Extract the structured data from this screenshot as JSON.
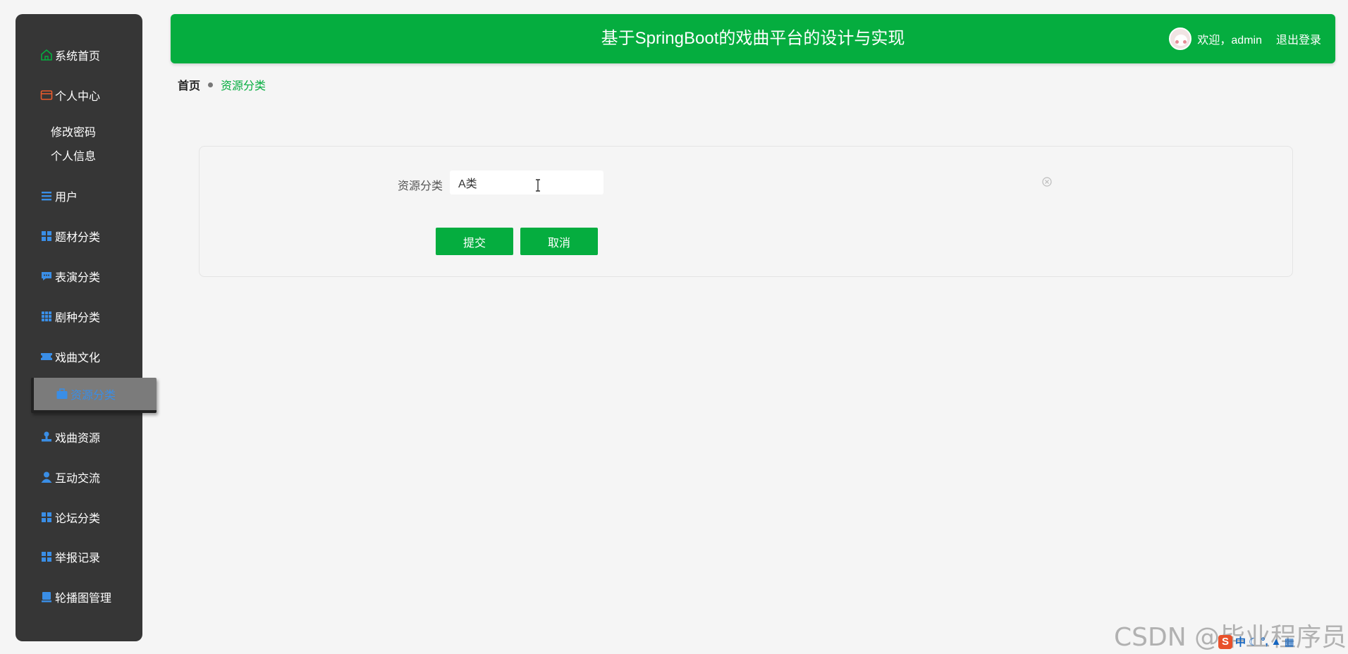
{
  "header": {
    "title": "基于SpringBoot的戏曲平台的设计与实现",
    "welcome": "欢迎，admin",
    "logout": "退出登录"
  },
  "sidebar": {
    "items": [
      {
        "label": "系统首页",
        "icon": "home-icon"
      },
      {
        "label": "个人中心",
        "icon": "wallet-icon"
      },
      {
        "label": "用户",
        "icon": "list-icon"
      },
      {
        "label": "题材分类",
        "icon": "grid-icon"
      },
      {
        "label": "表演分类",
        "icon": "chat-icon"
      },
      {
        "label": "剧种分类",
        "icon": "grid-nine-icon"
      },
      {
        "label": "戏曲文化",
        "icon": "ticket-icon"
      },
      {
        "label": "资源分类",
        "icon": "briefcase-icon"
      },
      {
        "label": "戏曲资源",
        "icon": "stamp-icon"
      },
      {
        "label": "互动交流",
        "icon": "user-icon"
      },
      {
        "label": "论坛分类",
        "icon": "grid-icon"
      },
      {
        "label": "举报记录",
        "icon": "grid-icon"
      },
      {
        "label": "轮播图管理",
        "icon": "monitor-icon"
      }
    ],
    "subitems": [
      {
        "label": "修改密码"
      },
      {
        "label": "个人信息"
      }
    ],
    "active": "资源分类"
  },
  "breadcrumb": {
    "home": "首页",
    "current": "资源分类"
  },
  "form": {
    "label": "资源分类",
    "value": "A类",
    "submit": "提交",
    "cancel": "取消"
  },
  "watermark": "CSDN @毕业程序员",
  "ime": {
    "mode": "中"
  },
  "colors": {
    "accent": "#05ad3f",
    "sidebar": "#363636",
    "active_text": "#3a8ee6",
    "icon_blue": "#3a8ee6",
    "icon_home": "#05ad3f",
    "icon_wallet": "#e85a2c"
  }
}
